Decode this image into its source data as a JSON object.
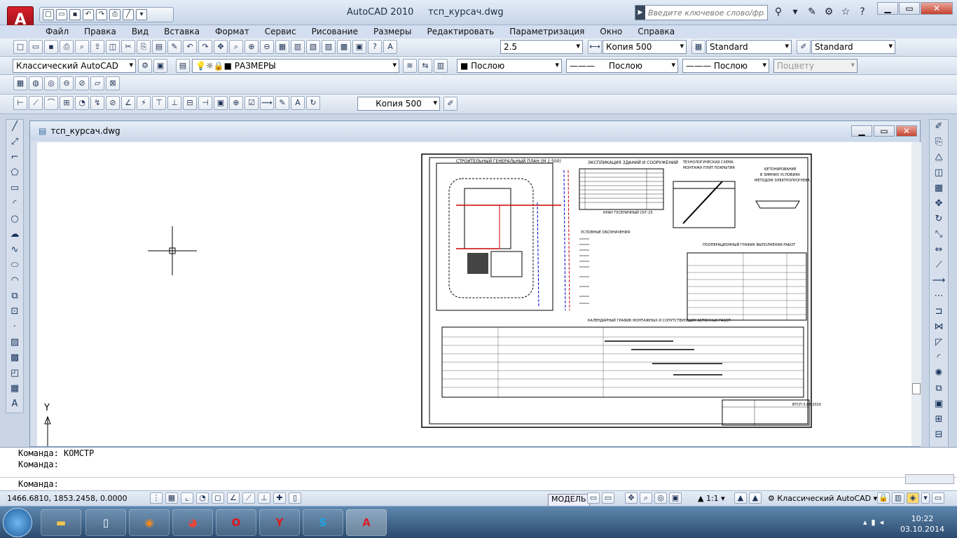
{
  "window": {
    "app_title": "AutoCAD 2010",
    "file_title": "тсп_курсач.dwg",
    "search_placeholder": "Введите ключевое слово/фразу",
    "logo_letter": "A"
  },
  "menu": [
    "Файл",
    "Правка",
    "Вид",
    "Вставка",
    "Формат",
    "Сервис",
    "Рисование",
    "Размеры",
    "Редактировать",
    "Параметризация",
    "Окно",
    "Справка"
  ],
  "toolbar1": {
    "text_height": "2.5",
    "text_style": "Копия 500",
    "dim_style": "Standard",
    "table_style": "Standard"
  },
  "toolbar2": {
    "workspace": "Классический AutoCAD",
    "layer": "РАЗМЕРЫ",
    "color": "Послою",
    "linetype": "Послою",
    "lineweight": "Послою",
    "plotstyle": "Поцвету"
  },
  "toolbar4": {
    "dim_style": "Копия 500"
  },
  "document": {
    "tab_title": "тсп_курсач.dwg",
    "ucs_y_label": "Y"
  },
  "drawing": {
    "plan_title": "СТРОИТЕЛЬНЫЙ ГЕНЕРАЛЬНЫЙ ПЛАН (М 1:500)",
    "explication_title": "ЭКСПЛИКАЦИЯ ЗДАНИЙ И СООРУЖЕНИЙ",
    "tech_title": "ТЕХНОЛОГИЧЕСКАЯ СХЕМА",
    "tech_subtitle": "МОНТАЖА ПЛИТ ПОКРЫТИЯ",
    "concrete_title": "БЕТОНИРОВАНИЕ",
    "concrete_sub1": "В ЗИМНИХ УСЛОВИЯХ",
    "concrete_sub2": "МЕТОДОМ ЭЛЕКТРОПРОГРЕВА",
    "schedule_title": "ПООПЕРАЦИОННЫЙ ГРАФИК ВЫПОЛНЕНИЯ РАБОТ",
    "legend_title": "УСЛОВНЫЕ ОБОЗНАЧЕНИЯ:",
    "crane_label": "КРАН ГУСЕНИЧНЫЙ СКГ-25",
    "calendar_title": "КАЛЕНДАРНЫЙ ГРАФИК МОНТАЖНЫХ И СОПУТСТВУЮЩИХ БЕТОННЫХ РАБОТ",
    "stamp_code": "ВТСП-3.08.2010"
  },
  "command": {
    "line1": "Команда:  КОМСТР",
    "line2": "Команда:",
    "prompt": "Команда:"
  },
  "status": {
    "coords": "1466.6810, 1853.2458, 0.0000",
    "model": "МОДЕЛЬ",
    "scale": "1:1",
    "workspace": "Классический AutoCAD"
  },
  "taskbar": {
    "time": "10:22",
    "date": "03.10.2014"
  }
}
